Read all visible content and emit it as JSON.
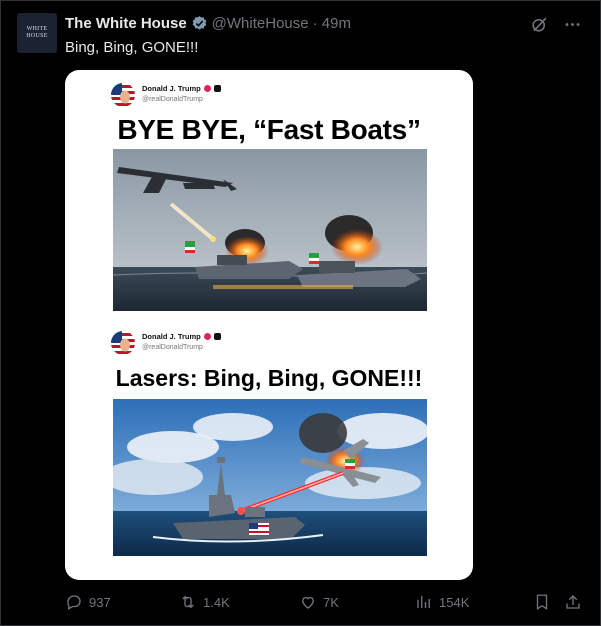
{
  "tweet": {
    "avatar_text": [
      "WHITE",
      "HOUSE"
    ],
    "author_name": "The White House",
    "author_handle": "@WhiteHouse",
    "time_ago": "· 49m",
    "text": "Bing, Bing, GONE!!!"
  },
  "media": {
    "post1": {
      "name": "Donald J. Trump",
      "handle": "@realDonaldTrump",
      "headline": "BYE BYE, “Fast Boats”"
    },
    "post2": {
      "name": "Donald J. Trump",
      "handle": "@realDonaldTrump",
      "headline": "Lasers: Bing, Bing, GONE!!!"
    }
  },
  "actions": {
    "replies": "937",
    "reposts": "1.4K",
    "likes": "7K",
    "views": "154K"
  },
  "colors": {
    "background": "#000000",
    "text": "#e7e9ea",
    "muted": "#71767b",
    "verified": "#829aab",
    "media_card": "#ffffff"
  },
  "icons": [
    "grok-icon",
    "more-icon",
    "verified-badge-icon",
    "reply-icon",
    "repost-icon",
    "like-icon",
    "views-icon",
    "bookmark-icon",
    "share-icon"
  ]
}
